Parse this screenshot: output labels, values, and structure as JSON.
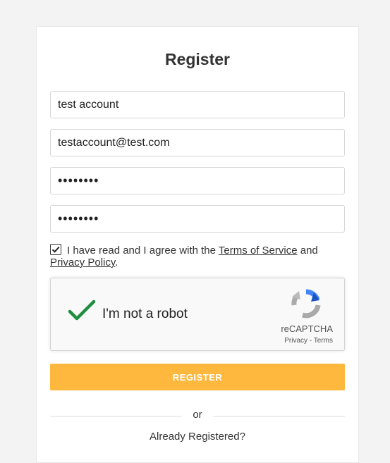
{
  "form": {
    "title": "Register",
    "name_value": "test account",
    "email_value": "testaccount@test.com",
    "password_value": "••••••••",
    "confirm_password_value": "••••••••",
    "terms_checked": true,
    "terms_prefix": "I have read and I agree with the ",
    "terms_link": "Terms of Service",
    "terms_and": " and",
    "privacy_link": "Privacy Policy",
    "terms_suffix": "."
  },
  "captcha": {
    "label": "I'm not a robot",
    "brand": "reCAPTCHA",
    "privacy": "Privacy",
    "separator": " - ",
    "terms": "Terms",
    "checkmark_color": "#1e8e3e"
  },
  "actions": {
    "register_label": "REGISTER",
    "or_label": "or",
    "already_registered": "Already Registered?"
  },
  "colors": {
    "accent": "#ffb83e"
  }
}
